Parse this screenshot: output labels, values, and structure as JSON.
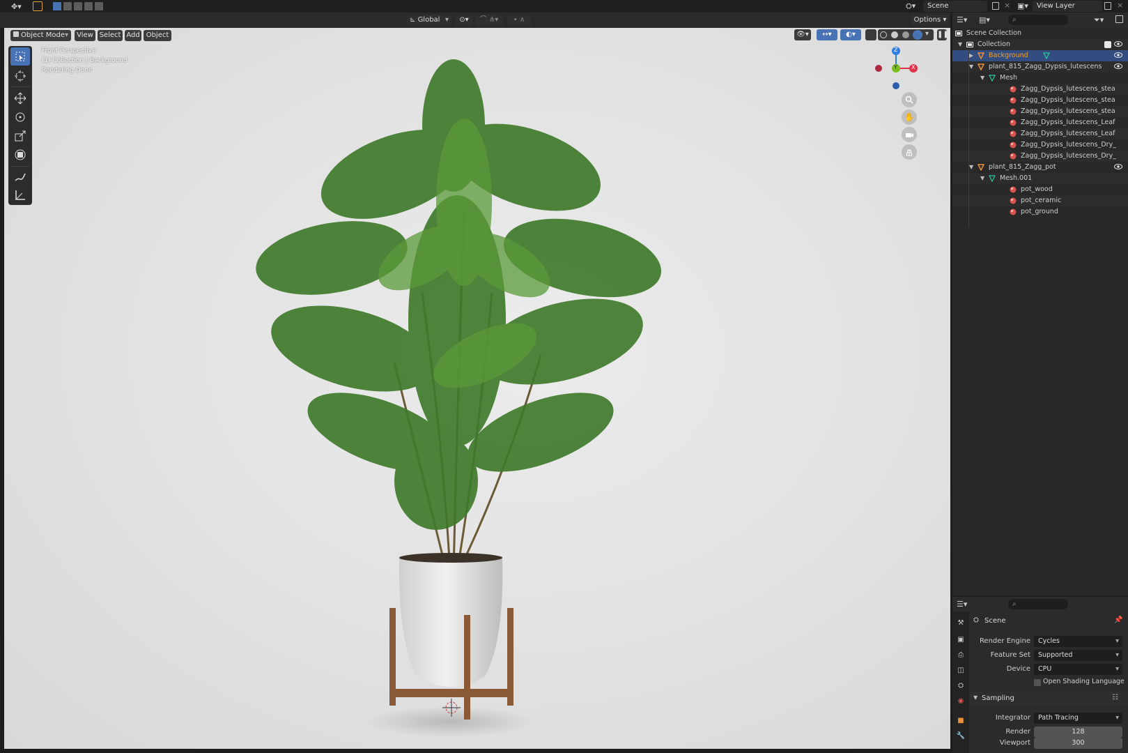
{
  "topbar": {
    "scene_label": "Scene",
    "view_layer_label": "View Layer"
  },
  "viewport_header": {
    "transform_orientation": "Global",
    "options_label": "Options"
  },
  "viewport_menu": {
    "mode": "Object Mode",
    "items": [
      "View",
      "Select",
      "Add",
      "Object"
    ]
  },
  "viewport_overlay": {
    "line1": "Front Perspective",
    "line2": "(1) Collection | Background",
    "line3": "Rendering Done"
  },
  "gizmo": {
    "z": "Z",
    "y": "Y",
    "x": "X"
  },
  "outliner": {
    "rows": [
      {
        "label": "Scene Collection"
      },
      {
        "label": "Collection"
      },
      {
        "label": "Background"
      },
      {
        "label": "plant_815_Zagg_Dypsis_lutescens"
      },
      {
        "label": "Mesh"
      },
      {
        "label": "Zagg_Dypsis_lutescens_stea"
      },
      {
        "label": "Zagg_Dypsis_lutescens_stea"
      },
      {
        "label": "Zagg_Dypsis_lutescens_stea"
      },
      {
        "label": "Zagg_Dypsis_lutescens_Leaf"
      },
      {
        "label": "Zagg_Dypsis_lutescens_Leaf"
      },
      {
        "label": "Zagg_Dypsis_lutescens_Dry_"
      },
      {
        "label": "Zagg_Dypsis_lutescens_Dry_"
      },
      {
        "label": "plant_815_Zagg_pot"
      },
      {
        "label": "Mesh.001"
      },
      {
        "label": "pot_wood"
      },
      {
        "label": "pot_ceramic"
      },
      {
        "label": "pot_ground"
      }
    ]
  },
  "properties": {
    "context": "Scene",
    "render_engine_label": "Render Engine",
    "render_engine": "Cycles",
    "feature_set_label": "Feature Set",
    "feature_set": "Supported",
    "device_label": "Device",
    "device": "CPU",
    "osl_label": "Open Shading Language",
    "sampling_label": "Sampling",
    "integrator_label": "Integrator",
    "integrator": "Path Tracing",
    "render_label": "Render",
    "render_samples": "128",
    "viewport_label": "Viewport",
    "viewport_samples": "300"
  },
  "colors": {
    "selection": "#334d80",
    "active_tool": "#4772b3",
    "axis_x": "#e0334d",
    "axis_y": "#7bbd1f",
    "axis_z": "#2f7fe0",
    "collection_icon": "#e8e8e8",
    "object_icon": "#e8913a",
    "mesh_icon": "#2cc8a0",
    "material_icon": "#d9534f"
  }
}
